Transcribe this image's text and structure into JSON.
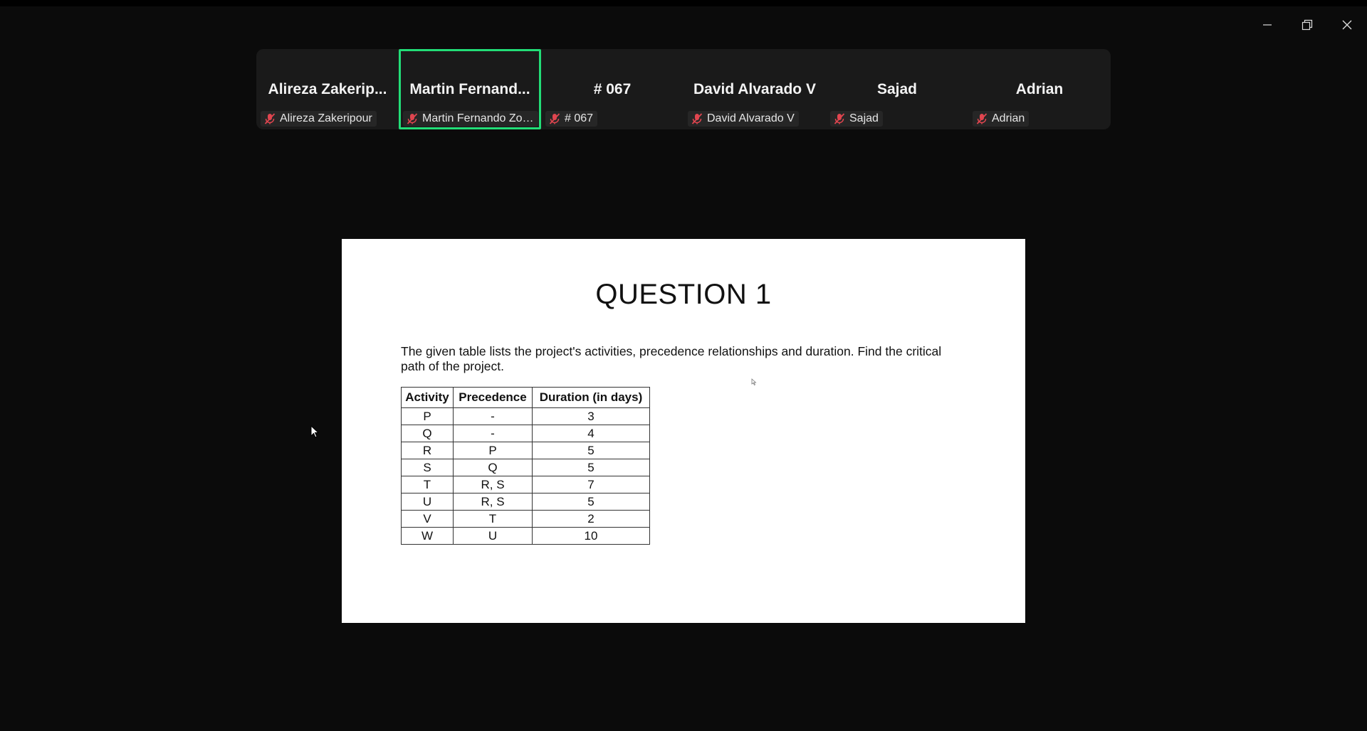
{
  "window": {
    "controls": [
      {
        "name": "minimize-icon"
      },
      {
        "name": "restore-icon"
      },
      {
        "name": "close-icon"
      }
    ]
  },
  "participants": [
    {
      "display": "Alireza Zakerip...",
      "label": "Alireza Zakeripour",
      "muted": true,
      "active": false
    },
    {
      "display": "Martin Fernand...",
      "label": "Martin Fernando Zorril...",
      "muted": true,
      "active": true
    },
    {
      "display": "# 067",
      "label": "# 067",
      "muted": true,
      "active": false
    },
    {
      "display": "David Alvarado V",
      "label": "David Alvarado V",
      "muted": true,
      "active": false
    },
    {
      "display": "Sajad",
      "label": "Sajad",
      "muted": true,
      "active": false
    },
    {
      "display": "Adrian",
      "label": "Adrian",
      "muted": true,
      "active": false
    }
  ],
  "colors": {
    "active_border": "#22dd77",
    "muted_icon": "#e0454f",
    "background": "#0b0b0b"
  },
  "slide": {
    "title": "QUESTION 1",
    "text": "The given table lists the project's activities, precedence relationships and duration. Find the critical path of the project.",
    "table": {
      "headers": [
        "Activity",
        "Precedence",
        "Duration (in days)"
      ],
      "rows": [
        [
          "P",
          "-",
          "3"
        ],
        [
          "Q",
          "-",
          "4"
        ],
        [
          "R",
          "P",
          "5"
        ],
        [
          "S",
          "Q",
          "5"
        ],
        [
          "T",
          "R, S",
          "7"
        ],
        [
          "U",
          "R, S",
          "5"
        ],
        [
          "V",
          "T",
          "2"
        ],
        [
          "W",
          "U",
          "10"
        ]
      ]
    }
  }
}
